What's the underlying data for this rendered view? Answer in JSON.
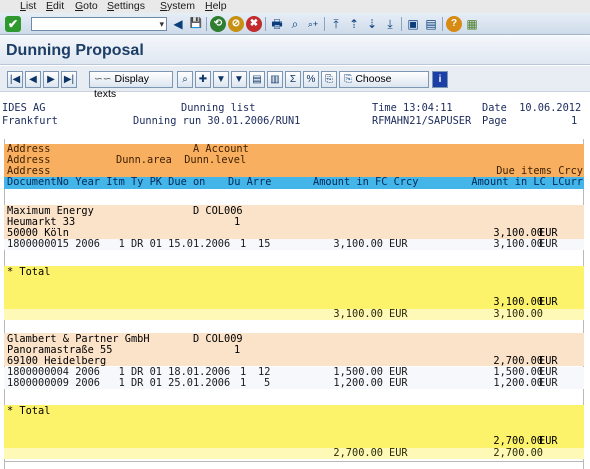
{
  "menu": [
    "List",
    "Edit",
    "Goto",
    "Settings",
    "System",
    "Help"
  ],
  "toolbar": {
    "ok_glyph": "✔",
    "history_glyph": "▾",
    "icons": [
      "◀",
      "💾",
      "⟲",
      "⊘",
      "✖",
      "🖶",
      "⌕",
      "⌕+",
      "⤒",
      "⇡",
      "⇣",
      "⤓",
      "▣",
      "▤",
      "?",
      "▦"
    ]
  },
  "title": "Dunning Proposal",
  "apptoolbar": {
    "nav": [
      "|◀",
      "◀",
      "▶",
      "▶|"
    ],
    "display_texts": "Display texts",
    "choose": "Choose",
    "info": "i",
    "tools": [
      "⌕",
      "✚",
      "▼",
      "▼",
      "▤",
      "▥",
      "Σ",
      "%",
      "⎘"
    ]
  },
  "header": {
    "company": "IDES AG",
    "city": "Frankfurt",
    "list_name": "Dunning list",
    "run": "Dunning run 30.01.2006/RUN1",
    "time": "Time 13:04:11",
    "program": "RFMAHN21/SAPUSER",
    "date": "Date  10.06.2012",
    "page_label": "Page",
    "page_no": "1"
  },
  "columns": {
    "h1a": "Address",
    "h1b": "A Account",
    "h2a": "Address",
    "h2b": "Dunn.area  Dunn.level",
    "h3a": "Address",
    "h3b": "Due items Crcy",
    "h4a": "DocumentNo Year Itm Ty PK Due on",
    "h4b": "Du Arre",
    "h4c": "Amount in FC Crcy",
    "h4d": "Amount in LC LCurr"
  },
  "customers": [
    {
      "name": "Maximum Energy",
      "account": "D COL006",
      "street": "Heumarkt 33",
      "level": "1",
      "city": "50000 Köln",
      "due": "3,100.00",
      "due_cur": "EUR",
      "items": [
        {
          "doc": "1800000015 2006   1 DR 01 15.01.2006",
          "du": "1",
          "arr": "15",
          "fc": "3,100.00",
          "fc_cur": "EUR",
          "lc": "3,100.00",
          "lc_cur": "EUR"
        }
      ],
      "total_label": "* Total",
      "total_due": "3,100.00",
      "total_due_cur": "EUR",
      "total_fc": "3,100.00",
      "total_fc_cur": "EUR",
      "total_lc": "3,100.00"
    },
    {
      "name": "Glambert & Partner GmbH",
      "account": "D COL009",
      "street": "Panoramastraße 55",
      "level": "1",
      "city": "69100 Heidelberg",
      "due": "2,700.00",
      "due_cur": "EUR",
      "items": [
        {
          "doc": "1800000004 2006   1 DR 01 18.01.2006",
          "du": "1",
          "arr": "12",
          "fc": "1,500.00",
          "fc_cur": "EUR",
          "lc": "1,500.00",
          "lc_cur": "EUR"
        },
        {
          "doc": "1800000009 2006   1 DR 01 25.01.2006",
          "du": "1",
          "arr": "5",
          "fc": "1,200.00",
          "fc_cur": "EUR",
          "lc": "1,200.00",
          "lc_cur": "EUR"
        }
      ],
      "total_label": "* Total",
      "total_due": "2,700.00",
      "total_due_cur": "EUR",
      "total_fc": "2,700.00",
      "total_fc_cur": "EUR",
      "total_lc": "2,700.00"
    }
  ]
}
